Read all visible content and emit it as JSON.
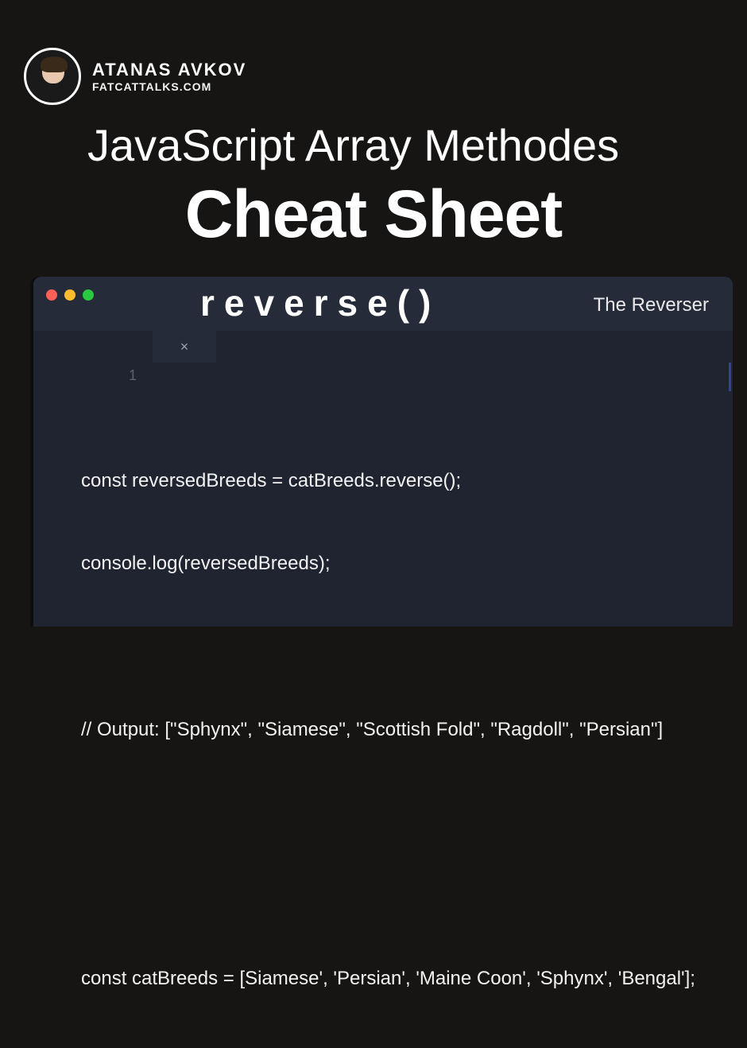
{
  "author": {
    "name": "ATANAS AVKOV",
    "site": "FATCATTALKS.COM"
  },
  "title": "JavaScript Array Methodes",
  "subtitle": "Cheat Sheet",
  "method": {
    "name": "reverse()",
    "tagline": "The Reverser"
  },
  "editor": {
    "line_number": "1",
    "code_lines": [
      "const reversedBreeds = catBreeds.reverse();",
      "console.log(reversedBreeds);",
      "",
      "// Output: [\"Sphynx\", \"Siamese\", \"Scottish Fold\", \"Ragdoll\", \"Persian\"]",
      "",
      "",
      "const catBreeds = [Siamese', 'Persian', 'Maine Coon', 'Sphynx', 'Bengal'];"
    ]
  },
  "traffic_colors": {
    "red": "#ff5f57",
    "yellow": "#febc2e",
    "green": "#28c840"
  }
}
